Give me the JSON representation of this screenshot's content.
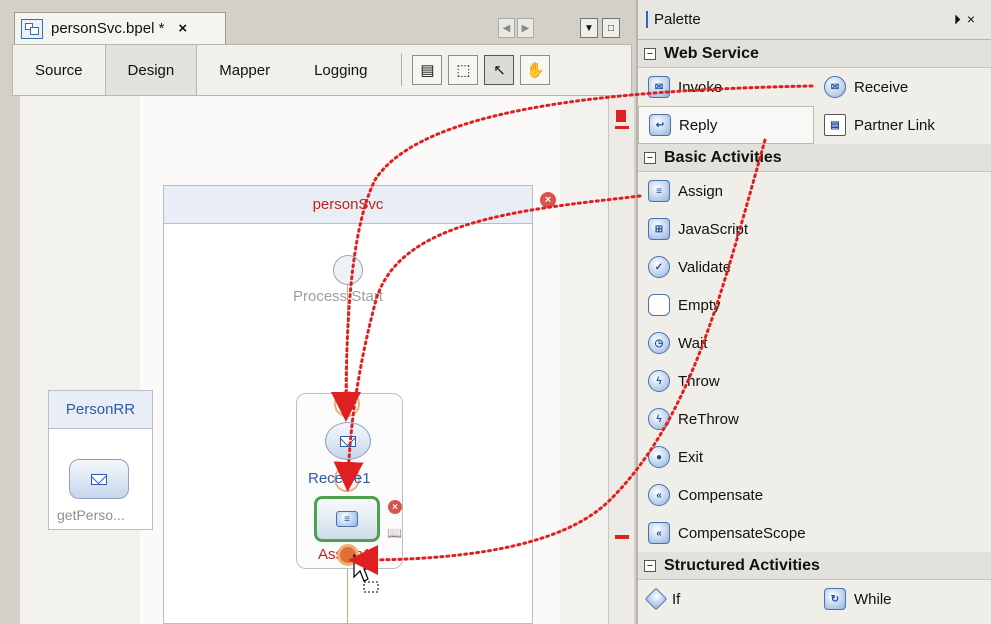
{
  "editor": {
    "file_tab_label": "personSvc.bpel *",
    "close_glyph": "×",
    "view_tabs": [
      "Source",
      "Design",
      "Mapper",
      "Logging"
    ],
    "active_view": "Design"
  },
  "diagram": {
    "process_title": "personSvc",
    "start_label": "Process Start",
    "receive_label": "Receive1",
    "assign_label": "Assign1",
    "partner_link_title": "PersonRR",
    "partner_operation_label": "getPerso..."
  },
  "palette": {
    "title": "Palette",
    "categories": [
      {
        "label": "Web Service",
        "items": [
          {
            "label": "Invoke",
            "icon": "invoke-icon"
          },
          {
            "label": "Receive",
            "icon": "receive-icon"
          },
          {
            "label": "Reply",
            "icon": "reply-icon"
          },
          {
            "label": "Partner Link",
            "icon": "partner-link-icon"
          }
        ]
      },
      {
        "label": "Basic Activities",
        "items": [
          {
            "label": "Assign",
            "icon": "assign-icon"
          },
          {
            "label": "JavaScript",
            "icon": "javascript-icon"
          },
          {
            "label": "Validate",
            "icon": "validate-icon"
          },
          {
            "label": "Empty",
            "icon": "empty-icon"
          },
          {
            "label": "Wait",
            "icon": "wait-icon"
          },
          {
            "label": "Throw",
            "icon": "throw-icon"
          },
          {
            "label": "ReThrow",
            "icon": "rethrow-icon"
          },
          {
            "label": "Exit",
            "icon": "exit-icon"
          },
          {
            "label": "Compensate",
            "icon": "compensate-icon"
          },
          {
            "label": "CompensateScope",
            "icon": "compensate-scope-icon"
          }
        ]
      },
      {
        "label": "Structured Activities",
        "items": [
          {
            "label": "If",
            "icon": "if-icon"
          },
          {
            "label": "While",
            "icon": "while-icon"
          }
        ]
      }
    ]
  },
  "colors": {
    "error_red": "#d9534f",
    "arrow_red": "#e02020",
    "selection_green": "#4ea14f",
    "link_blue": "#2d5aa7"
  }
}
